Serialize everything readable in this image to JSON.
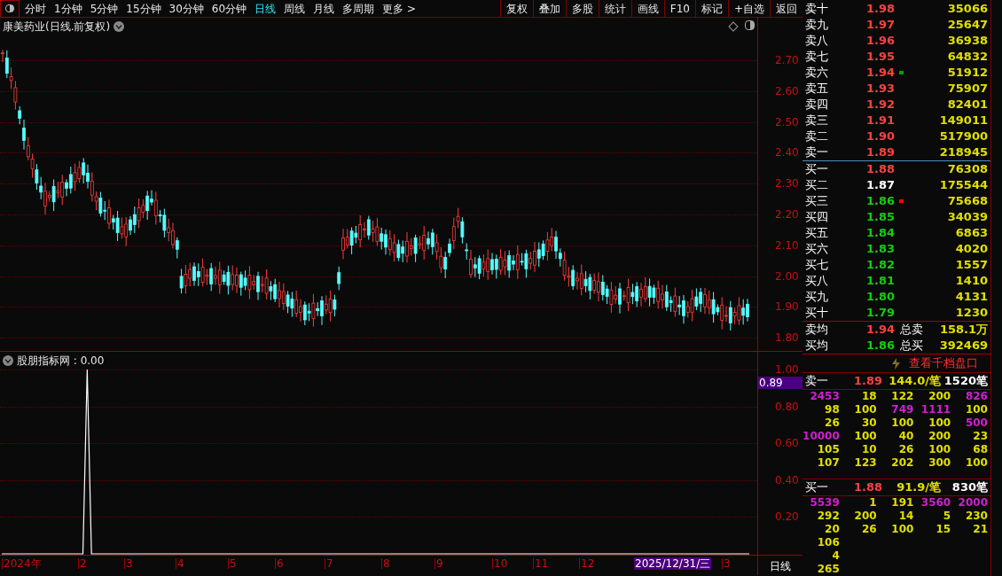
{
  "toolbar": {
    "periods": [
      {
        "label": "分时",
        "selected": false
      },
      {
        "label": "1分钟",
        "selected": false
      },
      {
        "label": "5分钟",
        "selected": false
      },
      {
        "label": "15分钟",
        "selected": false
      },
      {
        "label": "30分钟",
        "selected": false
      },
      {
        "label": "60分钟",
        "selected": false
      },
      {
        "label": "日线",
        "selected": true
      },
      {
        "label": "周线",
        "selected": false
      },
      {
        "label": "月线",
        "selected": false
      },
      {
        "label": "多周期",
        "selected": false
      },
      {
        "label": "更多 >",
        "selected": false
      }
    ],
    "actions": [
      "复权",
      "叠加",
      "多股",
      "统计",
      "画线",
      "F10",
      "标记",
      "+自选",
      "返回"
    ]
  },
  "chart": {
    "title": "康美药业(日线.前复权)",
    "price_ticks": [
      "2.70",
      "2.60",
      "2.50",
      "2.40",
      "2.30",
      "2.20",
      "2.10",
      "2.00",
      "1.90",
      "1.80"
    ]
  },
  "indicator": {
    "title": "股朋指标网 : 0.00",
    "cursor_value": "0.89",
    "chart_data": {
      "type": "line",
      "categories": [
        null,
        null,
        null,
        null,
        null,
        null,
        null,
        null,
        null,
        null,
        null,
        null,
        null,
        null,
        null,
        null,
        null,
        null,
        null,
        null,
        null,
        null,
        null,
        null,
        null,
        null,
        null,
        null,
        null,
        null,
        null,
        null,
        null,
        null,
        null,
        null,
        null,
        null,
        null,
        null,
        null,
        null,
        null,
        null,
        null,
        null,
        null,
        null,
        null,
        null,
        null,
        null,
        null,
        null,
        null,
        null,
        null,
        null,
        null,
        null,
        null,
        null,
        null,
        null,
        null,
        null,
        null,
        null,
        null,
        null,
        null,
        null,
        null,
        null,
        null,
        null,
        null,
        null,
        null,
        null,
        null,
        null,
        null,
        null,
        null,
        null,
        null,
        null,
        null,
        null,
        null,
        null,
        null,
        null,
        null,
        null,
        null,
        null,
        null,
        null,
        null,
        null,
        null,
        null,
        null,
        null,
        null,
        null,
        null,
        null,
        null,
        null,
        null,
        null,
        null,
        null,
        null,
        null,
        null,
        null,
        null,
        null,
        null,
        null,
        null,
        null,
        null,
        null,
        null,
        null,
        null,
        null,
        null,
        null,
        null,
        null,
        null,
        null,
        null,
        null,
        null,
        null,
        null,
        null,
        null,
        null,
        null,
        null,
        null,
        null,
        null,
        null,
        null,
        null,
        null,
        null,
        null,
        null,
        null,
        null,
        null,
        null,
        null,
        null,
        null,
        null,
        null,
        null,
        null,
        null,
        null,
        null,
        null,
        null,
        null,
        null
      ],
      "series": [
        {
          "color": "#ffffff",
          "values": [
            0,
            0,
            0,
            0,
            0,
            0,
            0,
            0,
            0,
            0,
            0,
            0,
            0,
            0,
            0,
            0,
            0,
            0,
            0,
            0,
            1,
            0,
            0,
            0,
            0,
            0,
            0,
            0,
            0,
            0,
            0,
            0,
            0,
            0,
            0,
            0,
            0,
            0,
            0,
            0,
            0,
            0,
            0,
            0,
            0,
            0,
            0,
            0,
            0,
            0,
            0,
            0,
            0,
            0,
            0,
            0,
            0,
            0,
            0,
            0,
            0,
            0,
            0,
            0,
            0,
            0,
            0,
            0,
            0,
            0,
            0,
            0,
            0,
            0,
            0,
            0,
            0,
            0,
            0,
            0,
            0,
            0,
            0,
            0,
            0,
            0,
            0,
            0,
            0,
            0,
            0,
            0,
            0,
            0,
            0,
            0,
            0,
            0,
            0,
            0,
            0,
            0,
            0,
            0,
            0,
            0,
            0,
            0,
            0,
            0,
            0,
            0,
            0,
            0,
            0,
            0,
            0,
            0,
            0,
            0,
            0,
            0,
            0,
            0,
            0,
            0,
            0,
            0,
            0,
            0,
            0,
            0,
            0,
            0,
            0,
            0,
            0,
            0,
            0,
            0,
            0,
            0,
            0,
            0,
            0,
            0,
            0,
            0,
            0,
            0,
            0,
            0,
            0,
            0,
            0,
            0,
            0,
            0,
            0,
            0,
            0,
            0,
            0,
            0,
            0,
            0,
            0,
            0,
            0,
            0,
            0,
            0,
            0,
            0,
            0,
            0
          ]
        }
      ],
      "ylim": [
        0,
        1
      ],
      "grid": true,
      "yticks": [
        {
          "value": 1,
          "label": "1.00"
        },
        {
          "value": 0.8,
          "label": "0.80"
        },
        {
          "value": 0.6,
          "label": "0.60"
        },
        {
          "value": 0.4,
          "label": "0.40"
        },
        {
          "value": 0.2,
          "label": "0.20"
        }
      ]
    }
  },
  "date_axis": {
    "labels": [
      "2024年",
      "2",
      "3",
      "4",
      "5",
      "6",
      "7",
      "8",
      "9",
      "10",
      "11",
      "12",
      "3"
    ],
    "cursor_date": "2025/12/31/三",
    "period": "日线"
  },
  "order_book": {
    "asks": [
      {
        "label": "卖十",
        "price": "1.98",
        "volume": "35066",
        "color": "#ff4040"
      },
      {
        "label": "卖九",
        "price": "1.97",
        "volume": "25647",
        "color": "#ff4040"
      },
      {
        "label": "卖八",
        "price": "1.96",
        "volume": "36938",
        "color": "#ff4040"
      },
      {
        "label": "卖七",
        "price": "1.95",
        "volume": "64832",
        "color": "#ff4040"
      },
      {
        "label": "卖六",
        "price": "1.94",
        "volume": "51912",
        "color": "#ff4040",
        "marker": {
          "color": "#00a000"
        }
      },
      {
        "label": "卖五",
        "price": "1.93",
        "volume": "75907",
        "color": "#ff4040"
      },
      {
        "label": "卖四",
        "price": "1.92",
        "volume": "82401",
        "color": "#ff4040"
      },
      {
        "label": "卖三",
        "price": "1.91",
        "volume": "149011",
        "color": "#ff4040"
      },
      {
        "label": "卖二",
        "price": "1.90",
        "volume": "517900",
        "color": "#ff4040"
      },
      {
        "label": "卖一",
        "price": "1.89",
        "volume": "218945",
        "color": "#ff4040"
      }
    ],
    "bids": [
      {
        "label": "买一",
        "price": "1.88",
        "volume": "76308",
        "color": "#ff4040"
      },
      {
        "label": "买二",
        "price": "1.87",
        "volume": "175544",
        "color": "#ffffff"
      },
      {
        "label": "买三",
        "price": "1.86",
        "volume": "75668",
        "color": "#10d010",
        "marker": {
          "color": "#ff0000"
        }
      },
      {
        "label": "买四",
        "price": "1.85",
        "volume": "34039",
        "color": "#10d010"
      },
      {
        "label": "买五",
        "price": "1.84",
        "volume": "6863",
        "color": "#10d010"
      },
      {
        "label": "买六",
        "price": "1.83",
        "volume": "4020",
        "color": "#10d010"
      },
      {
        "label": "买七",
        "price": "1.82",
        "volume": "1557",
        "color": "#10d010"
      },
      {
        "label": "买八",
        "price": "1.81",
        "volume": "1410",
        "color": "#10d010"
      },
      {
        "label": "买九",
        "price": "1.80",
        "volume": "4131",
        "color": "#10d010"
      },
      {
        "label": "买十",
        "price": "1.79",
        "volume": "1230",
        "color": "#10d010"
      }
    ],
    "averages": [
      {
        "label": "卖均",
        "price": "1.94",
        "color": "#ff4040",
        "total_label": "总卖",
        "total": "158.1万"
      },
      {
        "label": "买均",
        "price": "1.86",
        "color": "#10d010",
        "total_label": "总买",
        "total": "392469"
      }
    ]
  },
  "thousand_book": {
    "button": "查看千档盘口",
    "sections": [
      {
        "label": "卖一",
        "price": "1.89",
        "average": "144.0/笔",
        "count": "1520笔",
        "rows": [
          [
            {
              "value": "2453",
              "large": true
            },
            {
              "value": "18",
              "large": false
            },
            {
              "value": "122",
              "large": false
            },
            {
              "value": "200",
              "large": false
            },
            {
              "value": "826",
              "large": true
            }
          ],
          [
            {
              "value": "98",
              "large": false
            },
            {
              "value": "100",
              "large": false
            },
            {
              "value": "749",
              "large": true
            },
            {
              "value": "1111",
              "large": true
            },
            {
              "value": "100",
              "large": false
            }
          ],
          [
            {
              "value": "26",
              "large": false
            },
            {
              "value": "30",
              "large": false
            },
            {
              "value": "100",
              "large": false
            },
            {
              "value": "100",
              "large": false
            },
            {
              "value": "500",
              "large": true
            }
          ],
          [
            {
              "value": "10000",
              "large": true
            },
            {
              "value": "100",
              "large": false
            },
            {
              "value": "40",
              "large": false
            },
            {
              "value": "200",
              "large": false
            },
            {
              "value": "23",
              "large": false
            }
          ],
          [
            {
              "value": "105",
              "large": false
            },
            {
              "value": "10",
              "large": false
            },
            {
              "value": "26",
              "large": false
            },
            {
              "value": "100",
              "large": false
            },
            {
              "value": "68",
              "large": false
            }
          ],
          [
            {
              "value": "107",
              "large": false
            },
            {
              "value": "123",
              "large": false
            },
            {
              "value": "202",
              "large": false
            },
            {
              "value": "300",
              "large": false
            },
            {
              "value": "100",
              "large": false
            }
          ]
        ]
      },
      {
        "label": "买一",
        "price": "1.88",
        "average": "91.9/笔",
        "count": "830笔",
        "rows": [
          [
            {
              "value": "5539",
              "large": true
            },
            {
              "value": "1",
              "large": false
            },
            {
              "value": "191",
              "large": false
            },
            {
              "value": "3560",
              "large": true
            },
            {
              "value": "2000",
              "large": true
            }
          ],
          [
            {
              "value": "292",
              "large": false
            },
            {
              "value": "200",
              "large": false
            },
            {
              "value": "14",
              "large": false
            },
            {
              "value": "5",
              "large": false
            },
            {
              "value": "230",
              "large": false
            }
          ],
          [
            {
              "value": "20",
              "large": false
            },
            {
              "value": "26",
              "large": false
            },
            {
              "value": "100",
              "large": false
            },
            {
              "value": "15",
              "large": false
            },
            {
              "value": "21",
              "large": false
            }
          ],
          [
            {
              "value": "106",
              "large": false
            }
          ],
          [
            {
              "value": "4",
              "large": false
            }
          ],
          [
            {
              "value": "265",
              "large": false
            }
          ]
        ]
      }
    ]
  }
}
